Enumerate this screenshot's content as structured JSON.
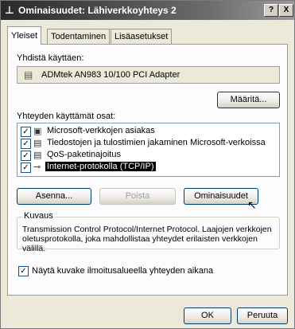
{
  "window": {
    "title": "Ominaisuudet: Lähiverkkoyhteys 2"
  },
  "titlebar_buttons": {
    "help": "?",
    "close": "X"
  },
  "tabs": [
    {
      "label": "Yleiset"
    },
    {
      "label": "Todentaminen"
    },
    {
      "label": "Lisäasetukset"
    }
  ],
  "connect_using": {
    "label": "Yhdistä käyttäen:",
    "adapter": "ADMtek AN983 10/100 PCI Adapter",
    "configure_button": "Määritä..."
  },
  "components": {
    "label": "Yhteyden käyttämät osat:",
    "items": [
      {
        "label": "Microsoft-verkkojen asiakas",
        "checked": true,
        "icon": "network-client-icon"
      },
      {
        "label": "Tiedostojen ja tulostimien jakaminen Microsoft-verkoissa",
        "checked": true,
        "icon": "file-printer-sharing-icon"
      },
      {
        "label": "QoS-paketinajoitus",
        "checked": true,
        "icon": "qos-scheduler-icon"
      },
      {
        "label": "Internet-protokolla (TCP/IP)",
        "checked": true,
        "icon": "protocol-icon",
        "selected": true
      }
    ],
    "install_button": "Asenna...",
    "remove_button": "Poista",
    "properties_button": "Ominaisuudet"
  },
  "description": {
    "label": "Kuvaus",
    "text": "Transmission Control Protocol/Internet Protocol. Laajojen verkkojen oletusprotokolla, joka mahdollistaa yhteydet erilaisten verkkojen välillä."
  },
  "show_icon": {
    "label": "Näytä kuvake ilmoitusalueella yhteyden aikana",
    "checked": true
  },
  "footer": {
    "ok": "OK",
    "cancel": "Peruuta"
  }
}
